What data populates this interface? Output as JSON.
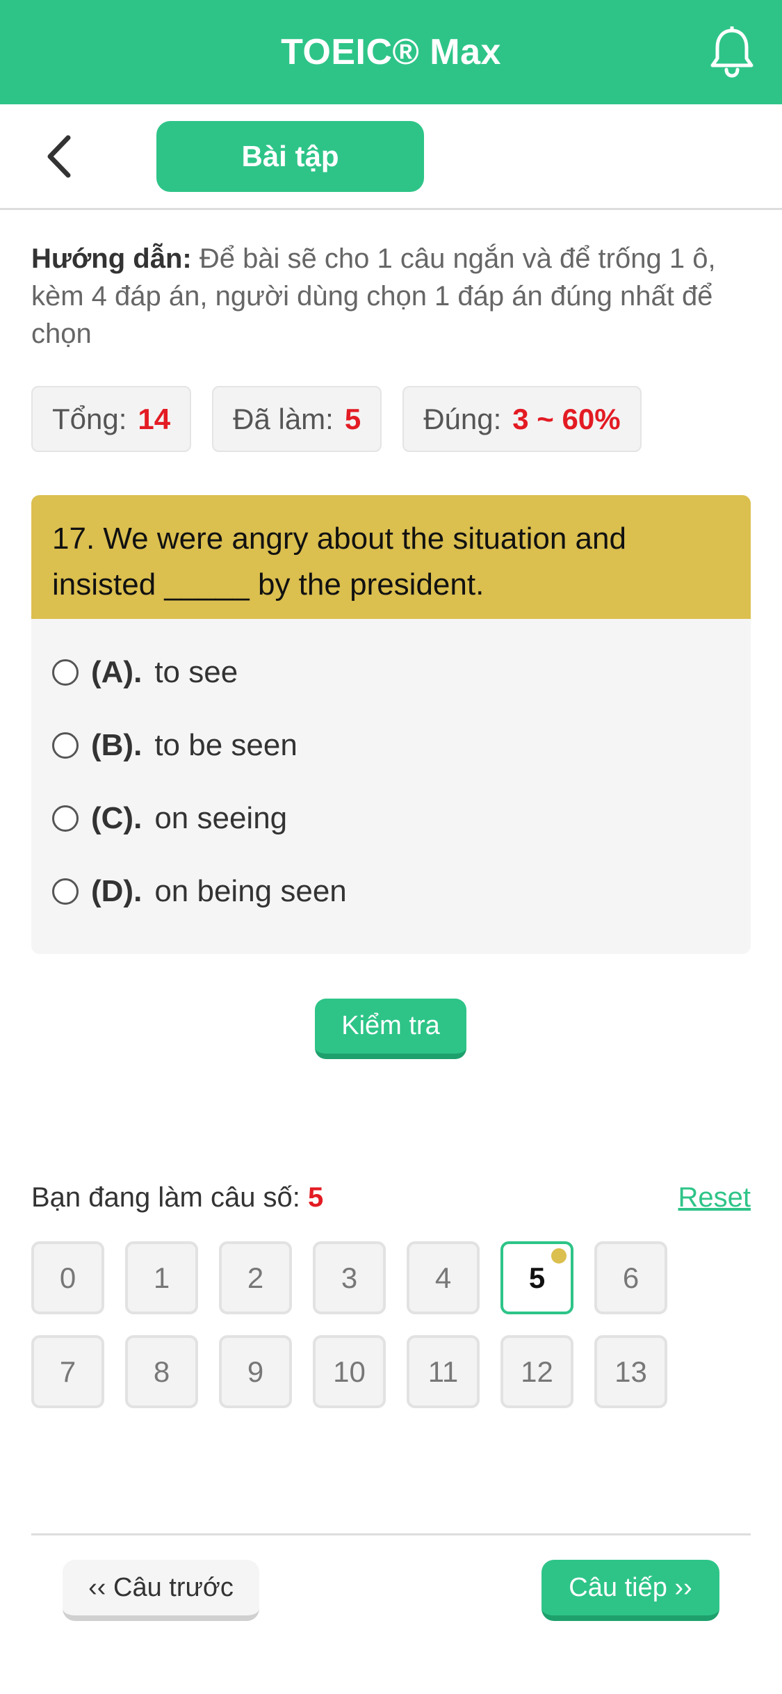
{
  "header": {
    "title": "TOEIC® Max",
    "bell_icon": "bell-icon"
  },
  "subbar": {
    "back_icon": "chevron-left-icon",
    "tab_label": "Bài tập"
  },
  "instructions": {
    "label": "Hướng dẫn:",
    "text": " Để bài sẽ cho 1 câu ngắn và để trống 1 ô, kèm 4 đáp án, người dùng chọn 1 đáp án đúng nhất để chọn"
  },
  "stats": [
    {
      "label": "Tổng:",
      "value": "14"
    },
    {
      "label": "Đã làm:",
      "value": "5"
    },
    {
      "label": "Đúng:",
      "value": "3 ~ 60%"
    }
  ],
  "question": {
    "text": "17. We were angry about the situation and insisted _____ by the president.",
    "options": [
      {
        "letter": "(A).",
        "text": "to see"
      },
      {
        "letter": "(B).",
        "text": "to be seen"
      },
      {
        "letter": "(C).",
        "text": "on seeing"
      },
      {
        "letter": "(D).",
        "text": "on being seen"
      }
    ]
  },
  "check_button": "Kiểm tra",
  "progress": {
    "label": "Bạn đang làm câu số:",
    "current": "5",
    "reset": "Reset",
    "cells": [
      "0",
      "1",
      "2",
      "3",
      "4",
      "5",
      "6",
      "7",
      "8",
      "9",
      "10",
      "11",
      "12",
      "13"
    ]
  },
  "nav": {
    "prev": "‹‹ Câu trước",
    "next": "Câu tiếp ››"
  },
  "colors": {
    "primary": "#2ec488",
    "question_header": "#dbbf4f",
    "accent_red": "#e31b23"
  }
}
